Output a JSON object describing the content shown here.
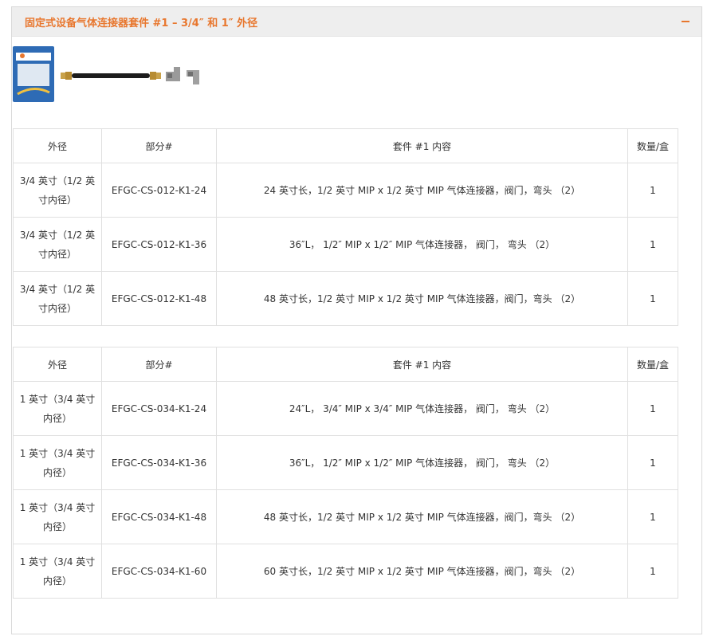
{
  "panel": {
    "title": "固定式设备气体连接器套件 #1 – 3/4″ 和 1″ 外径",
    "collapse_icon": "minus-icon",
    "accent_color": "#e8772e"
  },
  "image": {
    "alt": "gas connector kit product image"
  },
  "columns": [
    "外径",
    "部分#",
    "套件 #1 内容",
    "数量/盒"
  ],
  "table1": {
    "rows": [
      {
        "od": "3/4 英寸（1/2 英寸内径）",
        "part": "EFGC-CS-012-K1-24",
        "contents": "24 英寸长，1/2 英寸 MIP x 1/2 英寸 MIP 气体连接器，阀门，弯头 （2）",
        "qty": "1"
      },
      {
        "od": "3/4 英寸（1/2 英寸内径）",
        "part": "EFGC-CS-012-K1-36",
        "contents": "36″L， 1/2″ MIP x 1/2″ MIP 气体连接器， 阀门， 弯头 （2）",
        "qty": "1"
      },
      {
        "od": "3/4 英寸（1/2 英寸内径）",
        "part": "EFGC-CS-012-K1-48",
        "contents": "48 英寸长，1/2 英寸 MIP x 1/2 英寸 MIP 气体连接器，阀门，弯头 （2）",
        "qty": "1"
      }
    ]
  },
  "table2": {
    "rows": [
      {
        "od": "1 英寸（3/4 英寸内径）",
        "part": "EFGC-CS-034-K1-24",
        "contents": "24″L， 3/4″ MIP x 3/4″ MIP 气体连接器， 阀门， 弯头 （2）",
        "qty": "1"
      },
      {
        "od": "1 英寸（3/4 英寸内径）",
        "part": "EFGC-CS-034-K1-36",
        "contents": "36″L， 1/2″ MIP x 1/2″ MIP 气体连接器， 阀门， 弯头 （2）",
        "qty": "1"
      },
      {
        "od": "1 英寸（3/4 英寸内径）",
        "part": "EFGC-CS-034-K1-48",
        "contents": "48 英寸长，1/2 英寸 MIP x 1/2 英寸 MIP 气体连接器，阀门，弯头 （2）",
        "qty": "1"
      },
      {
        "od": "1 英寸（3/4 英寸内径）",
        "part": "EFGC-CS-034-K1-60",
        "contents": "60 英寸长，1/2 英寸 MIP x 1/2 英寸 MIP 气体连接器，阀门，弯头 （2）",
        "qty": "1"
      }
    ]
  }
}
